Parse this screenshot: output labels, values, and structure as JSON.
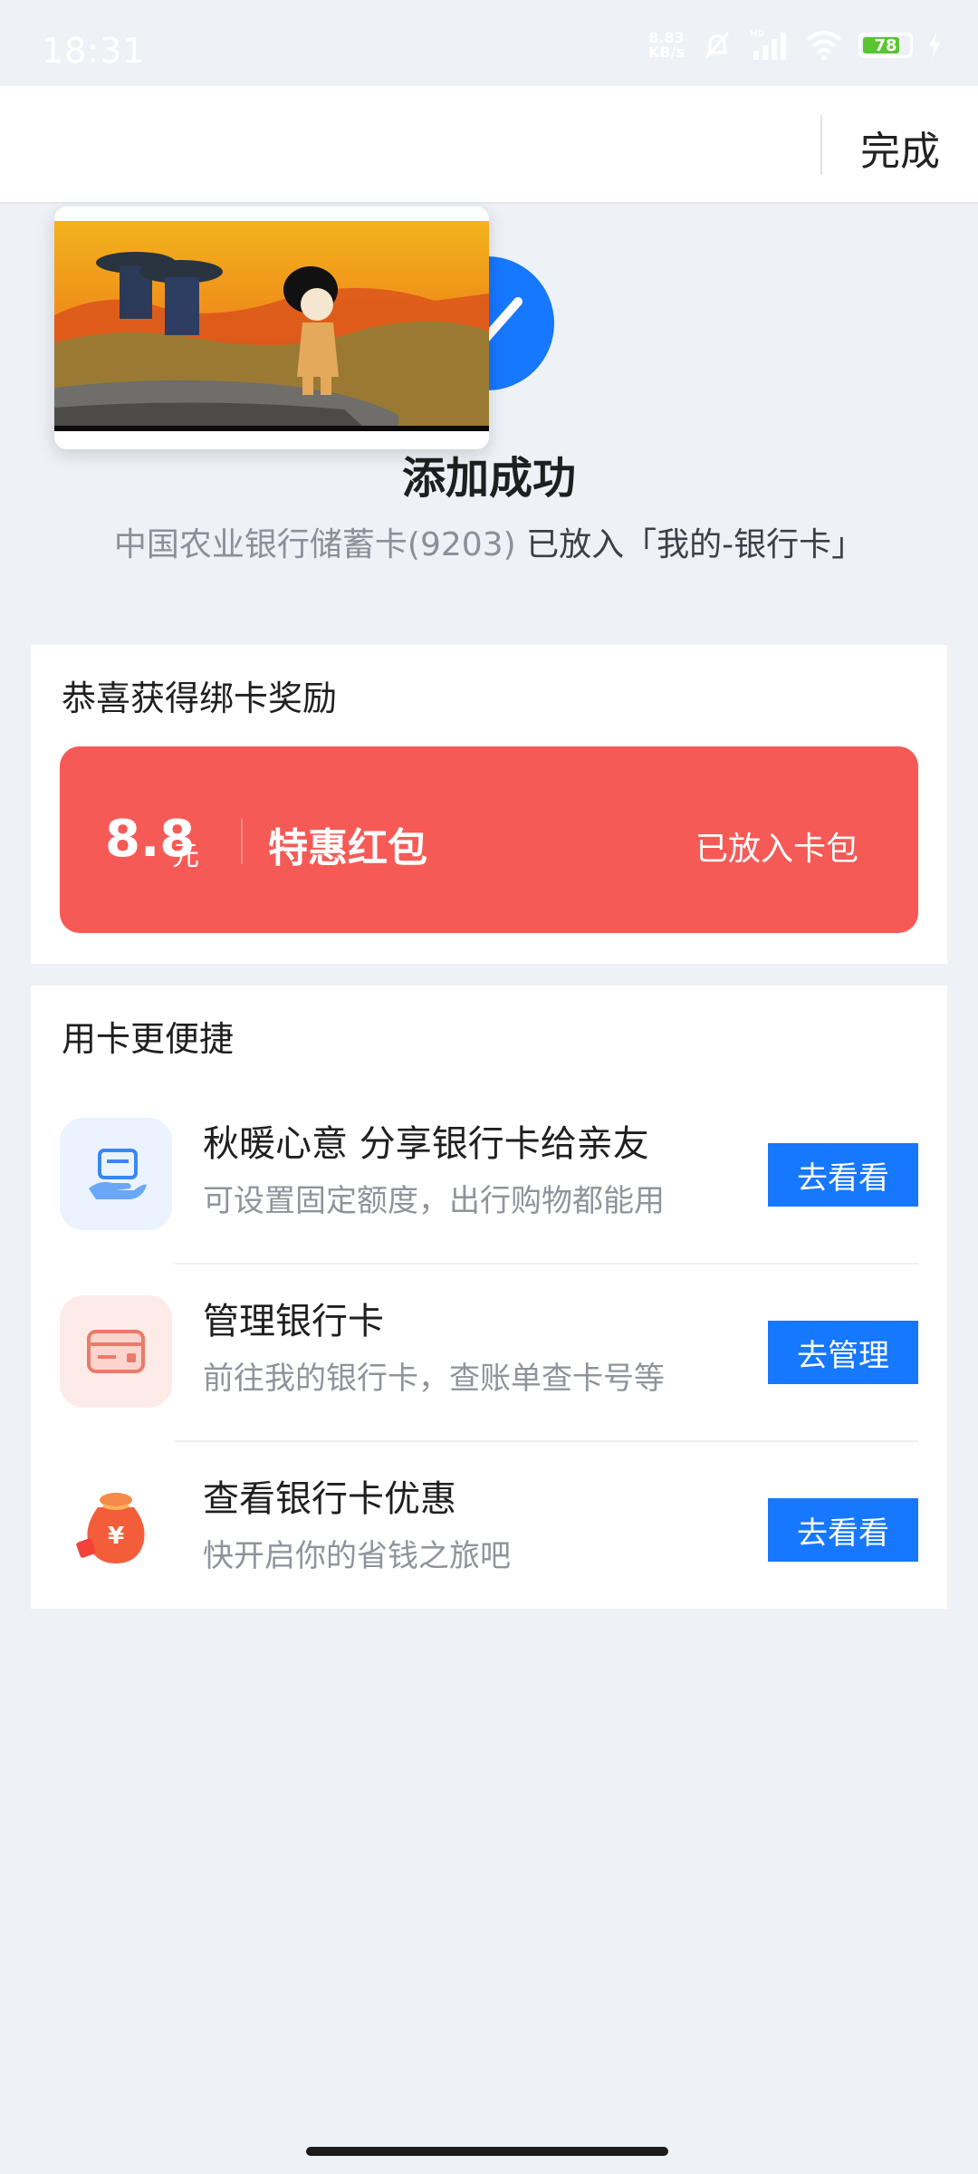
{
  "status_bar": {
    "time": "18:31",
    "net_speed_value": "8.83",
    "net_speed_unit": "KB/s",
    "battery": "78",
    "colors": {
      "battery_fill": "#5ac431"
    }
  },
  "header": {
    "done_label": "完成"
  },
  "success": {
    "title": "添加成功",
    "subtitle_card": "中国农业银行储蓄卡(9203)",
    "subtitle_action": "已放入「我的-银行卡」",
    "icon": "check-icon",
    "color": "#1677ff"
  },
  "reward": {
    "title": "恭喜获得绑卡奖励",
    "amount": "8.8",
    "unit": "元",
    "name": "特惠红包",
    "status": "已放入卡包",
    "color": "#f65a56"
  },
  "convenience": {
    "title": "用卡更便捷",
    "items": [
      {
        "title": "秋暖心意 分享银行卡给亲友",
        "subtitle": "可设置固定额度，出行购物都能用",
        "button": "去看看",
        "icon": "card-hand-icon"
      },
      {
        "title": "管理银行卡",
        "subtitle": "前往我的银行卡，查账单查卡号等",
        "button": "去管理",
        "icon": "bank-card-icon"
      },
      {
        "title": "查看银行卡优惠",
        "subtitle": "快开启你的省钱之旅吧",
        "button": "去看看",
        "icon": "money-bag-icon"
      }
    ],
    "button_color": "#1677ff"
  }
}
